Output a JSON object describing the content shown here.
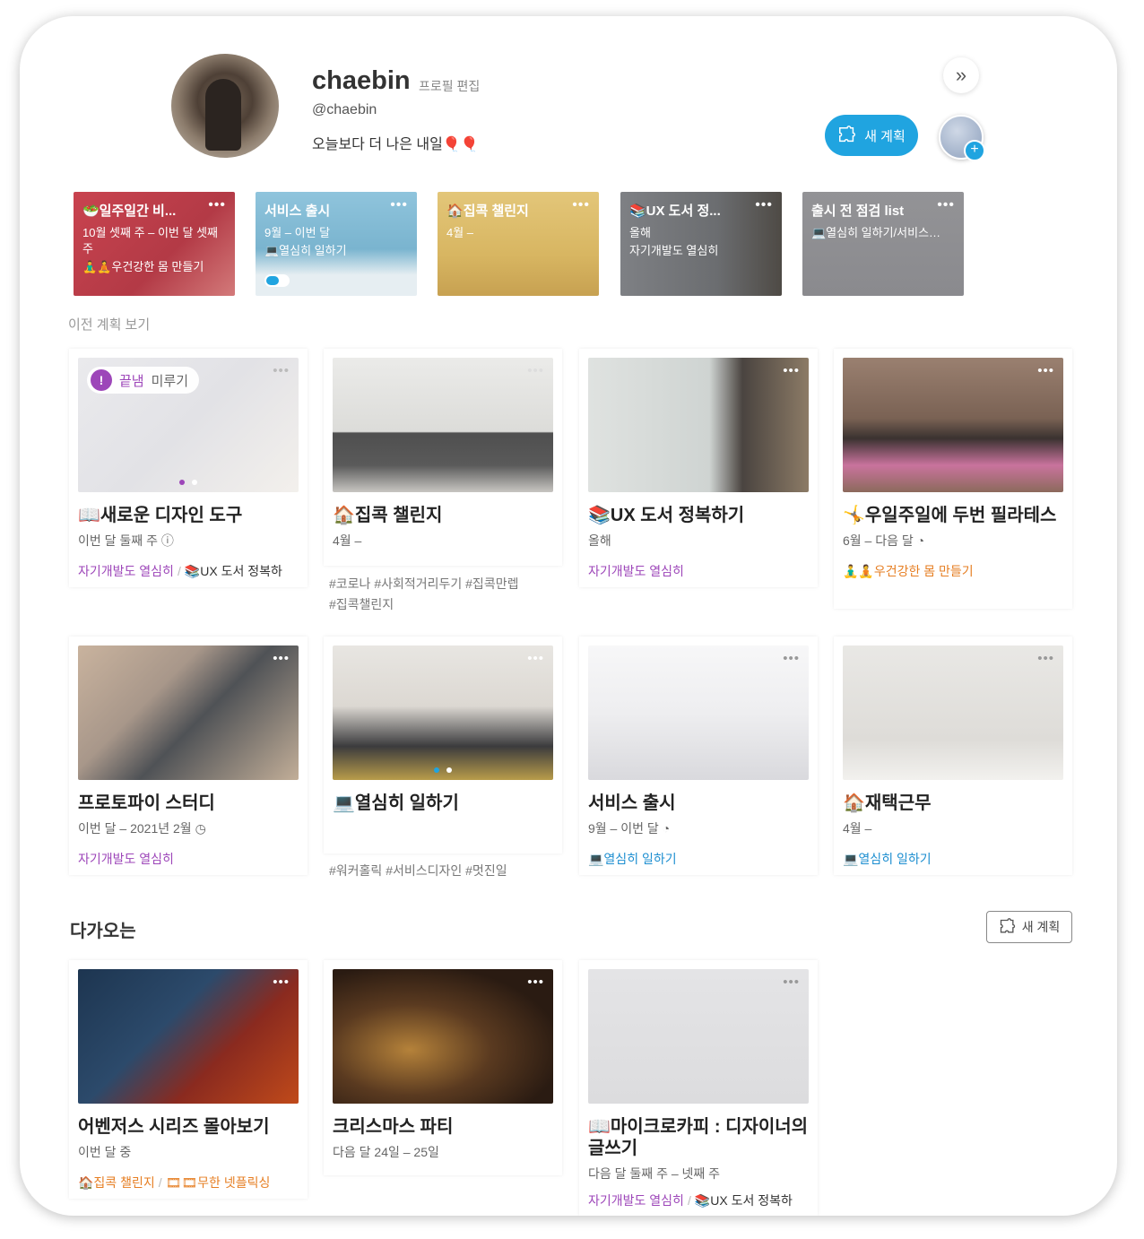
{
  "profile": {
    "username": "chaebin",
    "edit_label": "프로필 편집",
    "handle": "@chaebin",
    "bio": "오늘보다 더 나은 내일🎈🎈",
    "new_plan_label": "새 계획",
    "expand_icon": "double-chevron-right-icon"
  },
  "active_plans": [
    {
      "title": "🥗일주일간 비...",
      "subtitle": "10월 셋째 주 – 이번 달 셋째 주",
      "tag": "🧘‍♂️🧘우건강한 몸 만들기",
      "color": "#c9434f"
    },
    {
      "title": "서비스 출시",
      "subtitle": "9월 – 이번 달",
      "tag": "💻열심히 일하기",
      "color": "#8fc4dc"
    },
    {
      "title": "🏠집콕 챌린지",
      "subtitle": "4월 –",
      "tag": "",
      "color": "#e0bf6e"
    },
    {
      "title": "📚UX 도서 정...",
      "subtitle": "올해",
      "tag": "자기개발도 열심히",
      "color": "#6d6f74"
    },
    {
      "title": "출시 전 점검 list",
      "subtitle": "💻열심히 일하기/서비스…",
      "tag": "",
      "color": "#8f8f92"
    }
  ],
  "previous_link": "이전 계획 보기",
  "past_cards": [
    {
      "title": "📖새로운 디자인 도구",
      "date": "이번 달 둘째 주 ⓘ",
      "tag1": "자기개발도 열심히",
      "tag2": "📚UX 도서 정복하",
      "badge_done": "끝냄",
      "badge_postpone": "미루기",
      "badge_icon": "!"
    },
    {
      "title": "🏠집콕 챌린지",
      "date": "4월 –",
      "hashtags1": "#코로나 #사회적거리두기 #집콕만렙",
      "hashtags2": "#집콕챌린지"
    },
    {
      "title": "📚UX 도서 정복하기",
      "date": "올해",
      "tag1": "자기개발도 열심히"
    },
    {
      "title": "🤸우일주일에 두번 필라테스",
      "date": "6월 – 다음 달 ◔",
      "tag1": "🧘‍♂️🧘우건강한 몸 만들기"
    },
    {
      "title": "프로토파이 스터디",
      "date": "이번 달 – 2021년 2월 ◷",
      "tag1": "자기개발도 열심히"
    },
    {
      "title": "💻열심히 일하기",
      "date": "",
      "hashtags1": "#워커홀릭 #서비스디자인 #멋진일"
    },
    {
      "title": "서비스 출시",
      "date": "9월 – 이번 달 ◔",
      "tag1": "💻열심히 일하기"
    },
    {
      "title": "🏠재택근무",
      "date": "4월 –",
      "tag1": "💻열심히 일하기"
    }
  ],
  "upcoming": {
    "heading": "다가오는",
    "new_plan_label": "새 계획",
    "cards": [
      {
        "title": "어벤저스 시리즈 몰아보기",
        "date": "이번 달 중",
        "tag1": "🏠집콕 챌린지",
        "tag2": "🎞🎞무한 넷플릭싱"
      },
      {
        "title": "크리스마스 파티",
        "date": "다음 달 24일 – 25일"
      },
      {
        "title": "📖마이크로카피 : 디자이너의 글쓰기",
        "date": "다음 달 둘째 주 – 넷째 주",
        "tag1": "자기개발도 열심히",
        "tag2": "📚UX 도서 정복하"
      }
    ]
  },
  "more_icon": "more-dots-icon"
}
